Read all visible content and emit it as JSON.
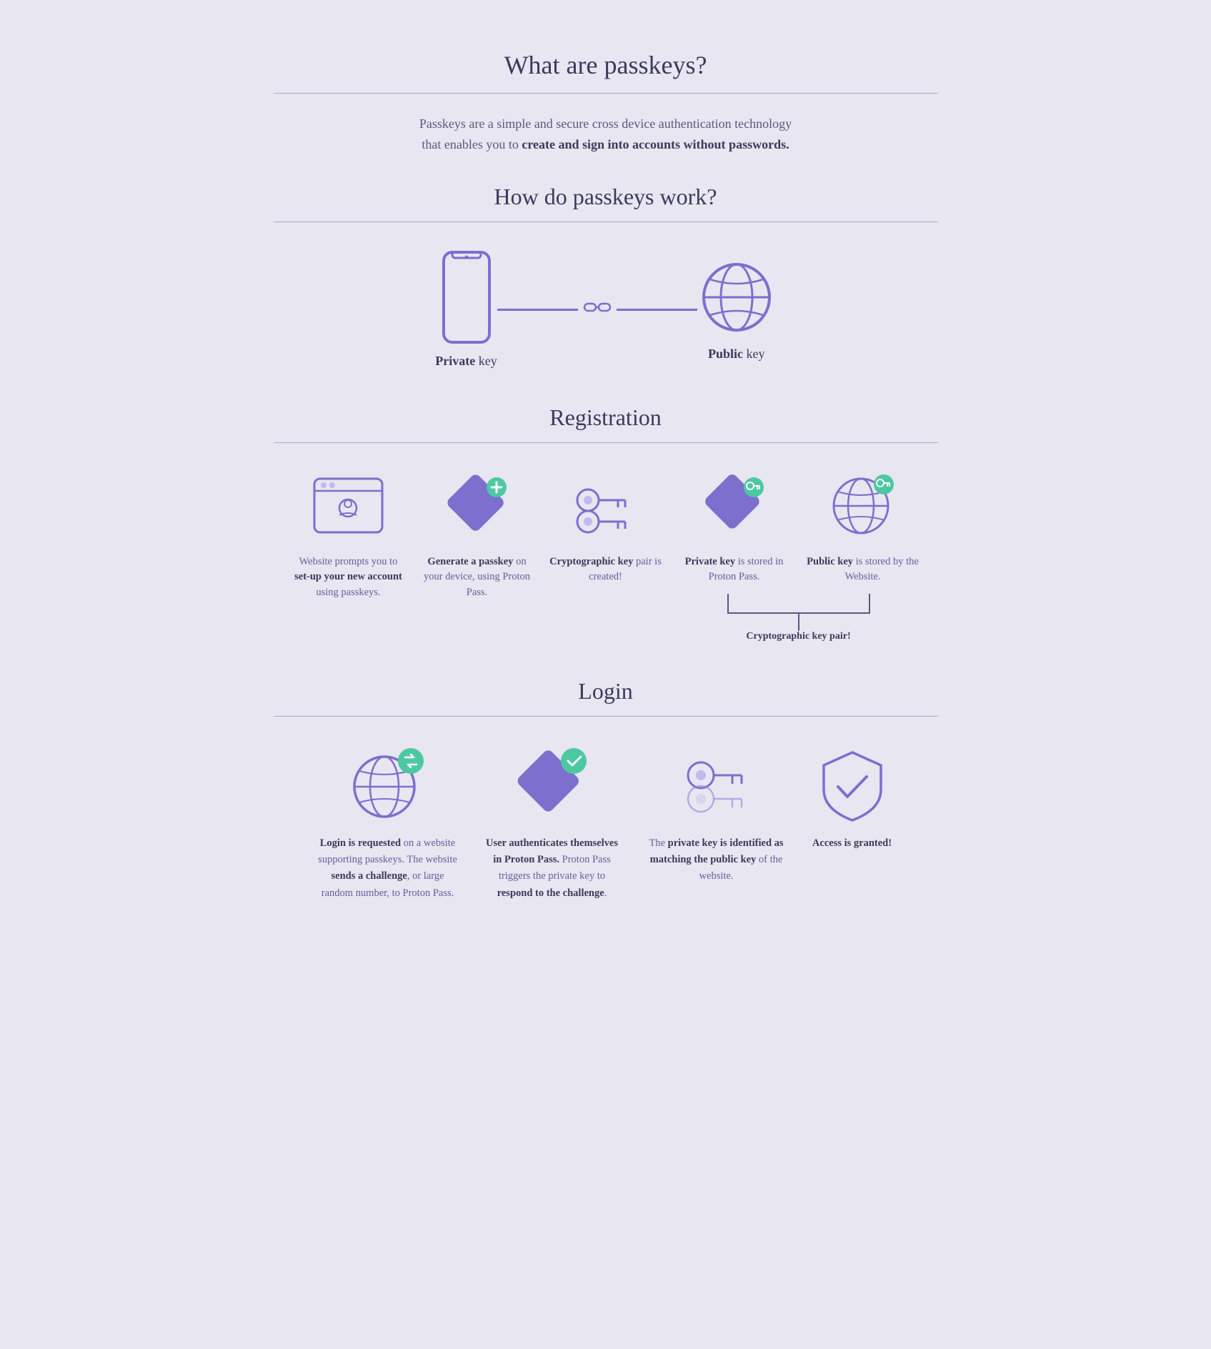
{
  "page": {
    "title": "What are passkeys?",
    "intro": {
      "line1": "Passkeys are a simple and secure cross device authentication technology",
      "line2": "that enables you to ",
      "line2_bold": "create and sign into accounts without passwords."
    },
    "how_title": "How do passkeys work?",
    "private_key_label": "Private",
    "private_key_suffix": " key",
    "public_key_label": "Public",
    "public_key_suffix": " key",
    "registration_title": "Registration",
    "reg_steps": [
      {
        "id": "reg-step-1",
        "text_plain": "Website prompts you to ",
        "text_bold": "set-up your new account",
        "text_after": " using passkeys."
      },
      {
        "id": "reg-step-2",
        "text_bold": "Generate a passkey",
        "text_after": " on your device, using Proton Pass."
      },
      {
        "id": "reg-step-3",
        "text_bold": "Cryptographic key",
        "text_after": " pair is created!"
      },
      {
        "id": "reg-step-4",
        "text_bold": "Private key",
        "text_after": " is stored in Proton Pass."
      },
      {
        "id": "reg-step-5",
        "text_bold": "Public key",
        "text_after": " is stored by the Website."
      }
    ],
    "crypto_key_pair_label": "Cryptographic key pair!",
    "login_title": "Login",
    "login_steps": [
      {
        "id": "login-step-1",
        "text_bold1": "Login is requested",
        "text_after1": " on a website supporting passkeys. The website ",
        "text_bold2": "sends a challenge",
        "text_after2": ", or large random number, to Proton Pass."
      },
      {
        "id": "login-step-2",
        "text_bold1": "User authenticates themselves in Proton Pass.",
        "text_after1": " Proton Pass triggers the private key to ",
        "text_bold2": "respond to the challenge",
        "text_after2": "."
      },
      {
        "id": "login-step-3",
        "text_plain": "The ",
        "text_bold1": "private key is identified as matching the public key",
        "text_after1": " of the website."
      },
      {
        "id": "login-step-4",
        "text_bold1": "Access is granted!"
      }
    ]
  }
}
